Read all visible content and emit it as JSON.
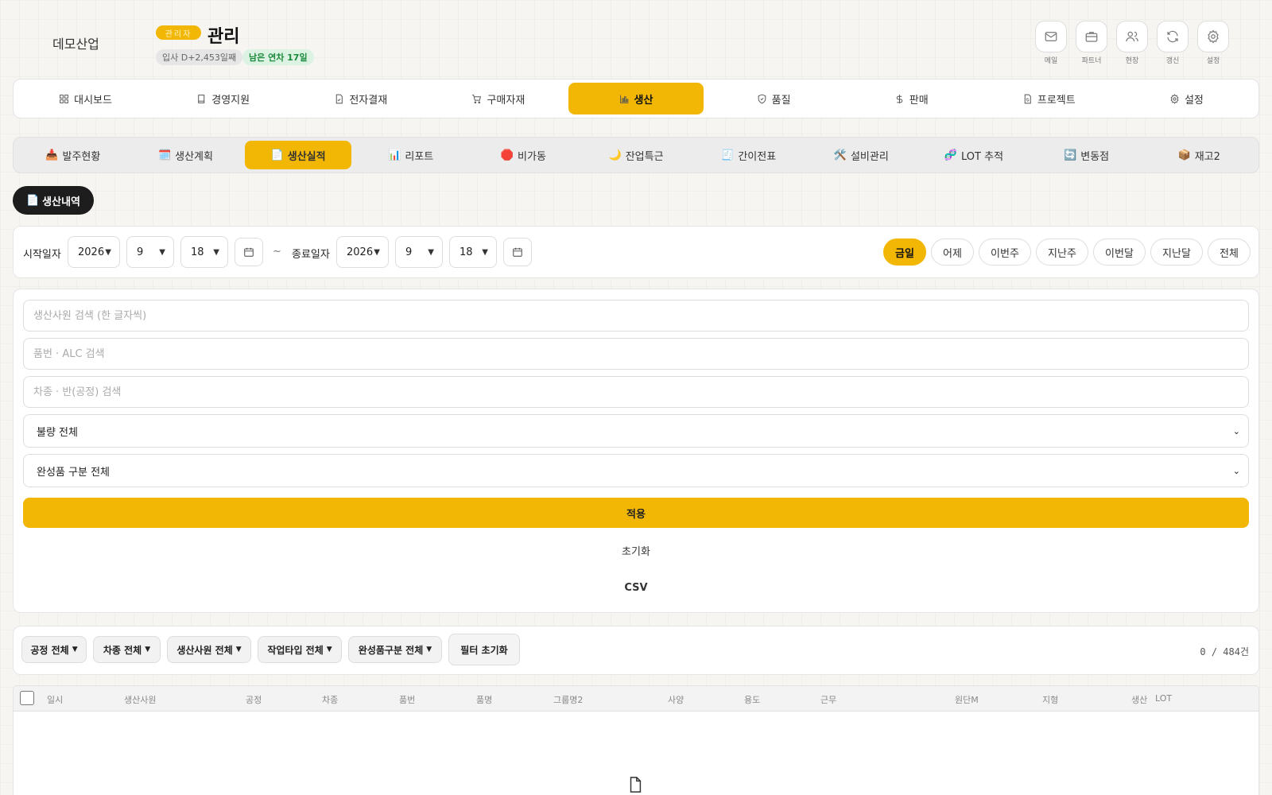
{
  "header": {
    "company": "데모산업",
    "role": "관리자",
    "title": "관리",
    "tenure": "입사 D+2,453일째",
    "leave": "남은 연차 17일",
    "icons": [
      {
        "icon": "mail-icon",
        "label": "메일"
      },
      {
        "icon": "briefcase-icon",
        "label": "파트너"
      },
      {
        "icon": "users-icon",
        "label": "현장"
      },
      {
        "icon": "refresh-icon",
        "label": "갱신"
      },
      {
        "icon": "gear-icon",
        "label": "설정"
      }
    ]
  },
  "main_nav": [
    {
      "label": "대시보드",
      "icon": "grid-icon"
    },
    {
      "label": "경영지원",
      "icon": "book-icon"
    },
    {
      "label": "전자결재",
      "icon": "file-check-icon"
    },
    {
      "label": "구매자재",
      "icon": "cart-icon"
    },
    {
      "label": "생산",
      "icon": "chart-icon",
      "active": true
    },
    {
      "label": "품질",
      "icon": "shield-icon"
    },
    {
      "label": "판매",
      "icon": "dollar-icon"
    },
    {
      "label": "프로젝트",
      "icon": "file-refresh-icon"
    },
    {
      "label": "설정",
      "icon": "gear-icon"
    }
  ],
  "sub_nav": [
    {
      "emoji": "📥",
      "label": "발주현황"
    },
    {
      "emoji": "🗓️",
      "label": "생산계획"
    },
    {
      "emoji": "📄",
      "label": "생산실적",
      "active": true
    },
    {
      "emoji": "📊",
      "label": "리포트"
    },
    {
      "emoji": "🛑",
      "label": "비가동"
    },
    {
      "emoji": "🌙",
      "label": "잔업특근"
    },
    {
      "emoji": "🧾",
      "label": "간이전표"
    },
    {
      "emoji": "🛠️",
      "label": "설비관리"
    },
    {
      "emoji": "🧬",
      "label": "LOT 추적"
    },
    {
      "emoji": "🔄",
      "label": "변동점"
    },
    {
      "emoji": "📦",
      "label": "재고2"
    }
  ],
  "section_pill": {
    "emoji": "📄",
    "label": "생산내역"
  },
  "date_filter": {
    "start_label": "시작일자",
    "start": {
      "year": "2026",
      "month": "9",
      "day": "18"
    },
    "tilde": "~",
    "end_label": "종료일자",
    "end": {
      "year": "2026",
      "month": "9",
      "day": "18"
    },
    "quick": [
      "금일",
      "어제",
      "이번주",
      "지난주",
      "이번달",
      "지난달",
      "전체"
    ],
    "quick_active": "금일"
  },
  "filters": {
    "worker_placeholder": "생산사원 검색 (한 글자씩)",
    "part_placeholder": "품번 · ALC 검색",
    "line_placeholder": "차종 · 반(공정) 검색",
    "defect_select": "불량 전체",
    "finished_select": "완성품 구분 전체",
    "apply": "적용",
    "reset": "초기화",
    "csv": "CSV"
  },
  "chips": [
    "공정 전체",
    "차종 전체",
    "생산사원 전체",
    "작업타입 전체",
    "완성품구분 전체"
  ],
  "chip_reset": "필터 초기화",
  "count": "0 / 484건",
  "table_columns": [
    "일시",
    "생산사원",
    "공정",
    "차종",
    "품번",
    "품명",
    "그룹명2",
    "사양",
    "용도",
    "근무",
    "원단M",
    "지형",
    "생산",
    "LOT"
  ]
}
